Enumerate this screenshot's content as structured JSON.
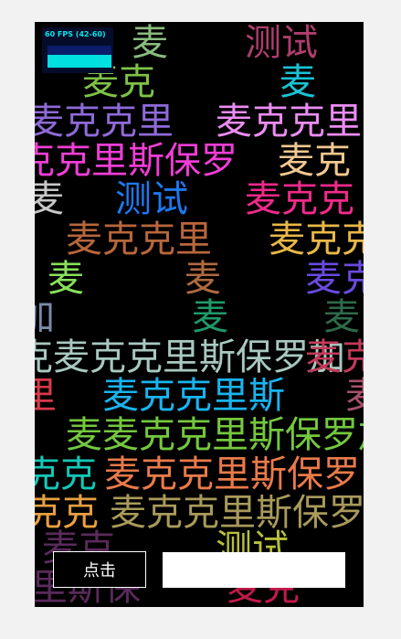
{
  "fps": {
    "label": "60 FPS (42-60)"
  },
  "controls": {
    "button_label": "点击",
    "input_value": ""
  },
  "floating_words": [
    {
      "text": "麦",
      "color": "#9ad08e",
      "opacity": 0.9
    },
    {
      "text": "测试",
      "color": "#c2447a",
      "opacity": 0.9
    },
    {
      "text": "麦克",
      "color": "#7ec246",
      "opacity": 1
    },
    {
      "text": "麦",
      "color": "#19c4d4",
      "opacity": 1
    },
    {
      "text": "麦克克里",
      "color": "#8e6ad8",
      "opacity": 1
    },
    {
      "text": "麦克克里",
      "color": "#ea8cf2",
      "opacity": 1
    },
    {
      "text": "克克里斯保罗",
      "color": "#f03ed6",
      "opacity": 1
    },
    {
      "text": "麦克",
      "color": "#f0c890",
      "opacity": 1
    },
    {
      "text": "麦",
      "color": "#c8c8c8",
      "opacity": 1
    },
    {
      "text": "测试",
      "color": "#1e78f0",
      "opacity": 1
    },
    {
      "text": "麦克克",
      "color": "#f02a8a",
      "opacity": 1
    },
    {
      "text": "麦克克里",
      "color": "#b8663c",
      "opacity": 1
    },
    {
      "text": "麦克克",
      "color": "#e8b848",
      "opacity": 1
    },
    {
      "text": "麦",
      "color": "#88e05a",
      "opacity": 1
    },
    {
      "text": "麦",
      "color": "#b06a40",
      "opacity": 1
    },
    {
      "text": "麦克",
      "color": "#6a4ae0",
      "opacity": 1
    },
    {
      "text": "加",
      "color": "#7a8aa8",
      "opacity": 1
    },
    {
      "text": "麦",
      "color": "#1e9a6a",
      "opacity": 1
    },
    {
      "text": "麦",
      "color": "#2e6a4a",
      "opacity": 1
    },
    {
      "text": "克麦克克里斯保罗加",
      "color": "#a8c8c0",
      "opacity": 1
    },
    {
      "text": "麦克",
      "color": "#c23a5a",
      "opacity": 1
    },
    {
      "text": "里",
      "color": "#d83a4a",
      "opacity": 1
    },
    {
      "text": "麦克克里斯",
      "color": "#19b4f0",
      "opacity": 1
    },
    {
      "text": "麦",
      "color": "#a8506a",
      "opacity": 1
    },
    {
      "text": "麦麦克克里斯保罗加",
      "color": "#74c83e",
      "opacity": 1
    },
    {
      "text": "克克",
      "color": "#14c8b8",
      "opacity": 1
    },
    {
      "text": "麦克克里斯保罗",
      "color": "#ea7a4a",
      "opacity": 1
    },
    {
      "text": "克克",
      "color": "#e8a040",
      "opacity": 1
    },
    {
      "text": "麦克克里斯保罗",
      "color": "#a89a5a",
      "opacity": 1
    },
    {
      "text": "麦克",
      "color": "#5a2a5a",
      "opacity": 1
    },
    {
      "text": "测试",
      "color": "#b8c03a",
      "opacity": 1
    },
    {
      "text": "里斯保",
      "color": "#5a2a5a",
      "opacity": 1
    },
    {
      "text": "麦克",
      "color": "#c21a4a",
      "opacity": 1
    }
  ]
}
